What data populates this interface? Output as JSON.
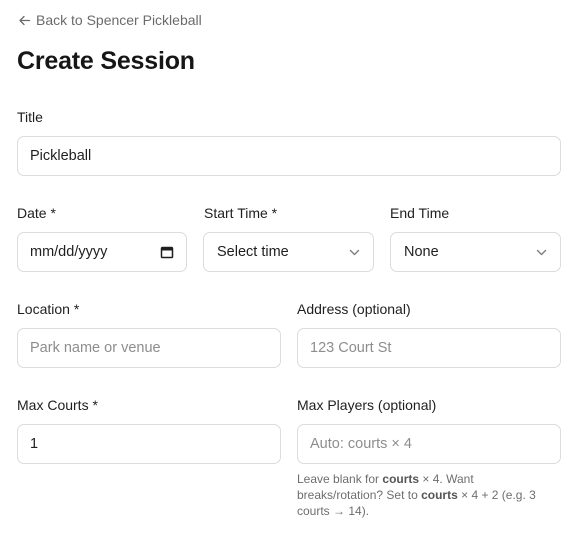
{
  "nav": {
    "back_arrow": "arrow-left-icon",
    "back_label": "Back to Spencer Pickleball"
  },
  "page": {
    "title": "Create Session"
  },
  "form": {
    "title": {
      "label": "Title",
      "value": "Pickleball"
    },
    "date": {
      "label": "Date *",
      "placeholder": "mm/dd/yyyy",
      "icon": "calendar-icon"
    },
    "start_time": {
      "label": "Start Time *",
      "selected": "Select time",
      "icon": "chevron-down-icon"
    },
    "end_time": {
      "label": "End Time",
      "selected": "None",
      "icon": "chevron-down-icon"
    },
    "location": {
      "label": "Location *",
      "placeholder": "Park name or venue",
      "value": ""
    },
    "address": {
      "label": "Address (optional)",
      "placeholder": "123 Court St",
      "value": ""
    },
    "max_courts": {
      "label": "Max Courts *",
      "value": "1"
    },
    "max_players": {
      "label": "Max Players (optional)",
      "placeholder": "Auto: courts × 4",
      "value": "",
      "help": {
        "part1": "Leave blank for ",
        "bold1": "courts",
        "part2": " × 4. Want breaks/rotation? Set to ",
        "bold2": "courts",
        "part3": " × 4 + 2 (e.g. 3 courts → 14)."
      }
    }
  },
  "colors": {
    "text": "#1f1f1f",
    "muted": "#6b6b6b",
    "border": "#dcdcdc",
    "placeholder": "#8d8d8d"
  }
}
